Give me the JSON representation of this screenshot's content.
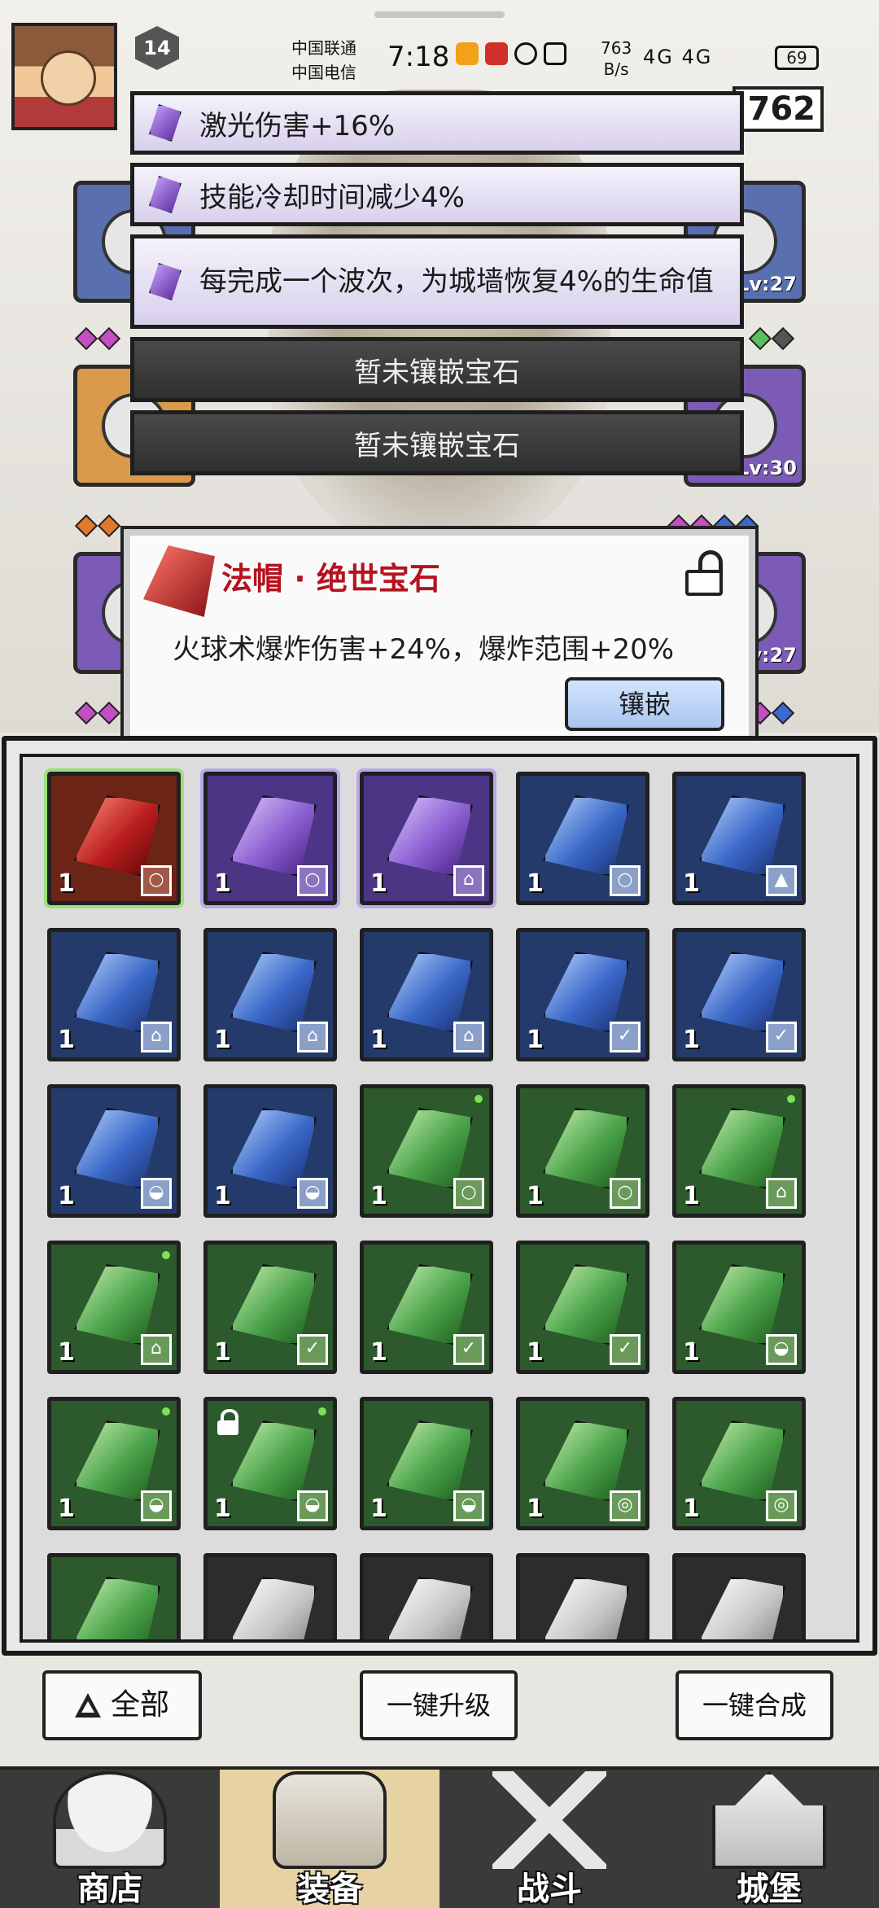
{
  "status_bar": {
    "carrier_1": "中国联通",
    "carrier_2": "中国电信",
    "time": "7:18",
    "net_speed": "763",
    "net_unit": "B/s",
    "signal": "4G 4G",
    "battery": "69"
  },
  "player": {
    "level": "14",
    "currency": "762"
  },
  "equipment_levels": {
    "right_top": "Lv:27",
    "right_mid": "Lv:30",
    "right_bottom": "v:27"
  },
  "gem_slots": [
    {
      "label": "激光伤害+16%",
      "state": "filled"
    },
    {
      "label": "技能冷却时间减少4%",
      "state": "filled"
    },
    {
      "label": "每完成一个波次，为城墙恢复4%的生命值",
      "state": "filled"
    },
    {
      "label": "暂未镶嵌宝石",
      "state": "empty"
    },
    {
      "label": "暂未镶嵌宝石",
      "state": "empty"
    }
  ],
  "gem_popup": {
    "title": "法帽 · 绝世宝石",
    "description": "火球术爆炸伤害+24%，爆炸范围+20%",
    "inlay_button": "镶嵌",
    "lock_icon": "unlock-icon"
  },
  "inventory": {
    "cells": [
      {
        "color": "red",
        "qty": "1",
        "equip": "ring",
        "new": false,
        "locked": false
      },
      {
        "color": "purple",
        "qty": "1",
        "equip": "ring",
        "new": false,
        "locked": false
      },
      {
        "color": "purple",
        "qty": "1",
        "equip": "boot",
        "new": false,
        "locked": false
      },
      {
        "color": "blue",
        "qty": "1",
        "equip": "ring",
        "new": false,
        "locked": false
      },
      {
        "color": "blue",
        "qty": "1",
        "equip": "armor",
        "new": false,
        "locked": false
      },
      {
        "color": "blue",
        "qty": "1",
        "equip": "boot",
        "new": false,
        "locked": false
      },
      {
        "color": "blue",
        "qty": "1",
        "equip": "boot",
        "new": false,
        "locked": false
      },
      {
        "color": "blue",
        "qty": "1",
        "equip": "boot",
        "new": false,
        "locked": false
      },
      {
        "color": "blue",
        "qty": "1",
        "equip": "staff",
        "new": false,
        "locked": false
      },
      {
        "color": "blue",
        "qty": "1",
        "equip": "staff",
        "new": false,
        "locked": false
      },
      {
        "color": "blue",
        "qty": "1",
        "equip": "hat",
        "new": false,
        "locked": false
      },
      {
        "color": "blue",
        "qty": "1",
        "equip": "hat",
        "new": false,
        "locked": false
      },
      {
        "color": "green",
        "qty": "1",
        "equip": "ring",
        "new": true,
        "locked": false
      },
      {
        "color": "green",
        "qty": "1",
        "equip": "ring",
        "new": false,
        "locked": false
      },
      {
        "color": "green",
        "qty": "1",
        "equip": "boot",
        "new": true,
        "locked": false
      },
      {
        "color": "green",
        "qty": "1",
        "equip": "boot",
        "new": true,
        "locked": false
      },
      {
        "color": "green",
        "qty": "1",
        "equip": "staff",
        "new": false,
        "locked": false
      },
      {
        "color": "green",
        "qty": "1",
        "equip": "staff",
        "new": false,
        "locked": false
      },
      {
        "color": "green",
        "qty": "1",
        "equip": "staff",
        "new": false,
        "locked": false
      },
      {
        "color": "green",
        "qty": "1",
        "equip": "hat",
        "new": false,
        "locked": false
      },
      {
        "color": "green",
        "qty": "1",
        "equip": "hat",
        "new": true,
        "locked": false
      },
      {
        "color": "green",
        "qty": "1",
        "equip": "hat",
        "new": true,
        "locked": true
      },
      {
        "color": "green",
        "qty": "1",
        "equip": "hat",
        "new": false,
        "locked": false
      },
      {
        "color": "green",
        "qty": "1",
        "equip": "amulet",
        "new": false,
        "locked": false
      },
      {
        "color": "green",
        "qty": "1",
        "equip": "amulet",
        "new": false,
        "locked": false
      },
      {
        "color": "green",
        "qty": "",
        "equip": "",
        "new": false,
        "locked": false
      },
      {
        "color": "gray",
        "qty": "",
        "equip": "",
        "new": false,
        "locked": false
      },
      {
        "color": "gray",
        "qty": "",
        "equip": "",
        "new": false,
        "locked": false
      },
      {
        "color": "gray",
        "qty": "",
        "equip": "",
        "new": false,
        "locked": false
      },
      {
        "color": "gray",
        "qty": "",
        "equip": "",
        "new": false,
        "locked": false
      }
    ]
  },
  "actions": {
    "filter_all": "全部",
    "upgrade_all": "一键升级",
    "merge_all": "一键合成"
  },
  "tabs": [
    {
      "label": "商店",
      "icon": "shop-icon",
      "active": false
    },
    {
      "label": "装备",
      "icon": "bag-icon",
      "active": true
    },
    {
      "label": "战斗",
      "icon": "swords-icon",
      "active": false
    },
    {
      "label": "城堡",
      "icon": "castle-icon",
      "active": false
    }
  ]
}
